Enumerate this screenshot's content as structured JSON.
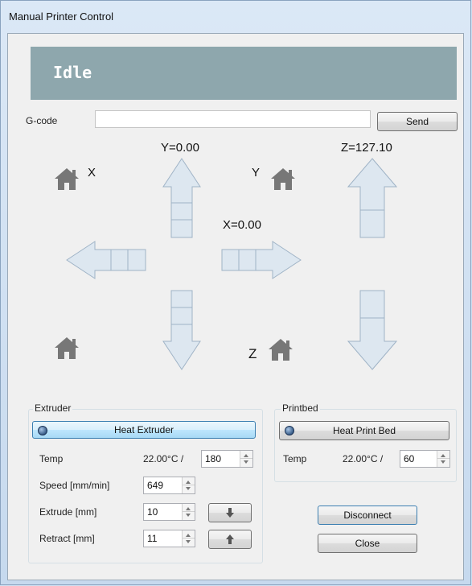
{
  "window": {
    "title": "Manual Printer Control"
  },
  "status": {
    "text": "Idle"
  },
  "gcode": {
    "label": "G-code",
    "value": "",
    "send_label": "Send"
  },
  "axes": {
    "y_position": "Y=0.00",
    "x_position": "X=0.00",
    "z_position": "Z=127.10",
    "home_x_label": "X",
    "home_y_label": "Y",
    "home_z_label": "Z"
  },
  "extruder": {
    "group_title": "Extruder",
    "heat_label": "Heat Extruder",
    "temp_label": "Temp",
    "temp_current": "22.00°C /",
    "temp_target": "180",
    "speed_label": "Speed [mm/min]",
    "speed_value": "649",
    "extrude_label": "Extrude [mm]",
    "extrude_value": "10",
    "retract_label": "Retract [mm]",
    "retract_value": "11"
  },
  "printbed": {
    "group_title": "Printbed",
    "heat_label": "Heat Print Bed",
    "temp_label": "Temp",
    "temp_current": "22.00°C /",
    "temp_target": "60"
  },
  "buttons": {
    "disconnect_label": "Disconnect",
    "close_label": "Close"
  },
  "icons": {
    "home": "home-icon",
    "arrow": "arrow-icon",
    "led": "status-led-icon",
    "down": "arrow-down-icon",
    "up": "arrow-up-icon"
  },
  "colors": {
    "status_bar": "#8ea7ad",
    "arrow_fill": "#dde7f0",
    "arrow_stroke": "#9fb3c6"
  }
}
